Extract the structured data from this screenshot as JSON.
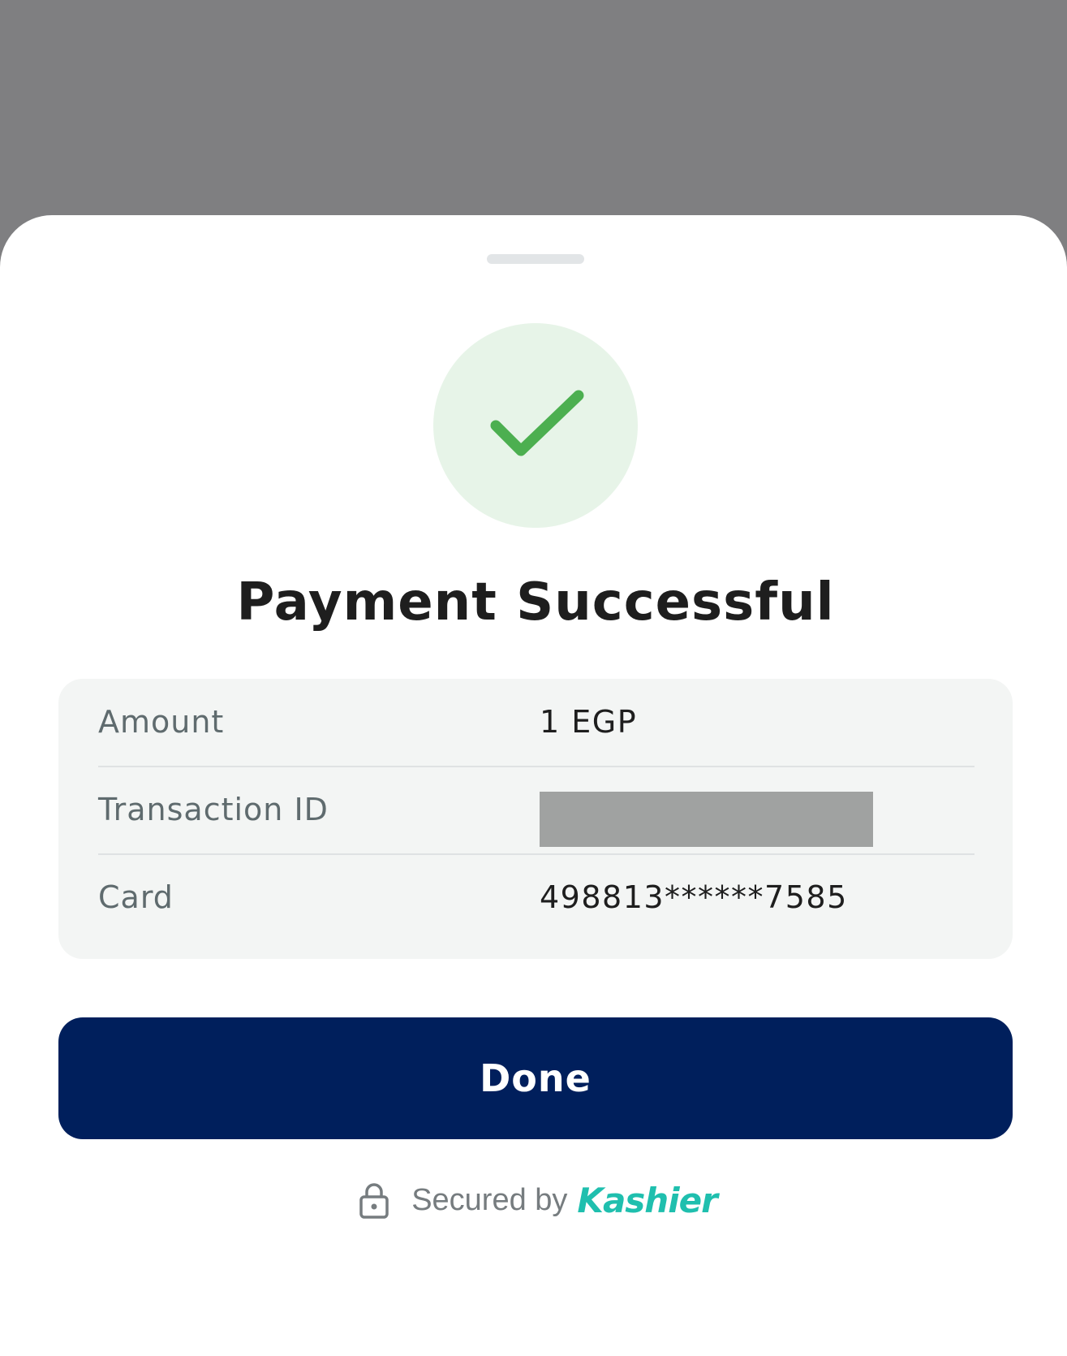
{
  "modal": {
    "title": "Payment Successful",
    "status_icon": "check-icon",
    "colors": {
      "success_green": "#4caf50",
      "success_bg": "#e7f4e8",
      "primary_navy": "#001f5c",
      "brand_teal": "#1fbfae"
    }
  },
  "details": {
    "amount_label": "Amount",
    "amount_value": "1 EGP",
    "transaction_label": "Transaction ID",
    "card_label": "Card",
    "card_value": "498813******7585"
  },
  "actions": {
    "done_label": "Done"
  },
  "footer": {
    "secured_text": "Secured by",
    "brand_name": "Kashier",
    "lock_icon": "lock-icon"
  }
}
